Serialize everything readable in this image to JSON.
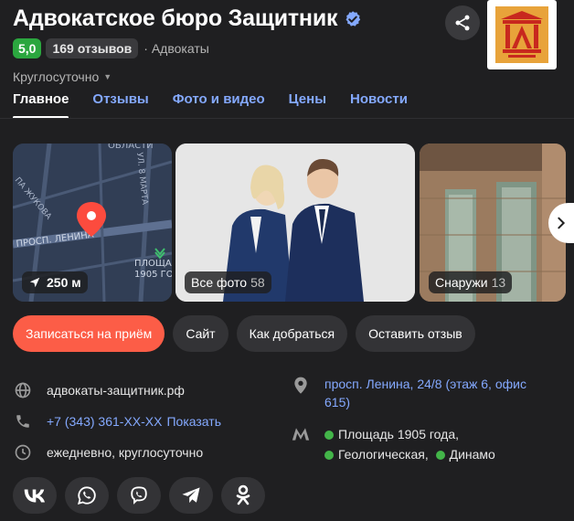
{
  "header": {
    "title": "Адвокатское бюро Защитник",
    "rating": "5,0",
    "reviews_count": "169 отзывов",
    "category": "· Адвокаты",
    "hours": "Круглосуточно"
  },
  "tabs": [
    {
      "label": "Главное",
      "active": true
    },
    {
      "label": "Отзывы",
      "active": false
    },
    {
      "label": "Фото и видео",
      "active": false
    },
    {
      "label": "Цены",
      "active": false
    },
    {
      "label": "Новости",
      "active": false
    }
  ],
  "gallery": {
    "map": {
      "distance": "250 м",
      "street_labels": [
        "ОБЛАСТИ",
        "ПА ЖУКОВА",
        "УЛ. 8 МАРТА",
        "ПРОСП. ЛЕНИНА",
        "ПЛОЩА",
        "1905 ГО"
      ]
    },
    "all_photos": {
      "label": "Все фото",
      "count": "58"
    },
    "outside": {
      "label": "Снаружи",
      "count": "13"
    }
  },
  "actions": {
    "book": "Записаться на приём",
    "site": "Сайт",
    "route": "Как добраться",
    "review": "Оставить отзыв"
  },
  "contacts": {
    "website": "адвокаты-защитник.рф",
    "phone": "+7 (343) 361-XX-XX",
    "phone_show": "Показать",
    "schedule": "ежедневно, круглосуточно",
    "address": "просп. Ленина, 24/8 (этаж 6, офис 615)",
    "metro": [
      {
        "name": "Площадь 1905 года,",
        "color": "#43b549"
      },
      {
        "name": "Геологическая,",
        "color": "#43b549"
      },
      {
        "name": "Динамо",
        "color": "#43b549"
      }
    ]
  },
  "socials": [
    "vk-icon",
    "whatsapp-icon",
    "viber-icon",
    "telegram-icon",
    "odnoklassniki-icon"
  ],
  "colors": {
    "background": "#1f1f21",
    "accent_link": "#84a9ff",
    "primary_button": "#fc5d47",
    "rating_badge": "#2ba63f",
    "metro_line": "#43b549"
  }
}
